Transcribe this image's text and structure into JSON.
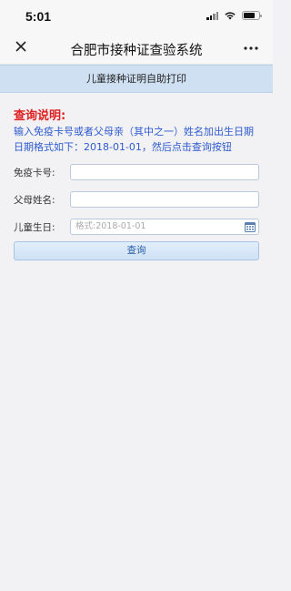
{
  "status": {
    "time": "5:01"
  },
  "nav": {
    "title": "合肥市接种证查验系统"
  },
  "subheader": {
    "text": "儿童接种证明自助打印"
  },
  "notice": {
    "title": "查询说明:",
    "line1": "输入免疫卡号或者父母亲（其中之一）姓名加出生日期",
    "line2": "日期格式如下：2018-01-01，然后点击查询按钮"
  },
  "form": {
    "card_label": "免疫卡号:",
    "card_value": "",
    "parent_label": "父母姓名:",
    "parent_value": "",
    "birth_label": "儿童生日:",
    "birth_placeholder": "格式:2018-01-01",
    "submit_label": "查询"
  }
}
